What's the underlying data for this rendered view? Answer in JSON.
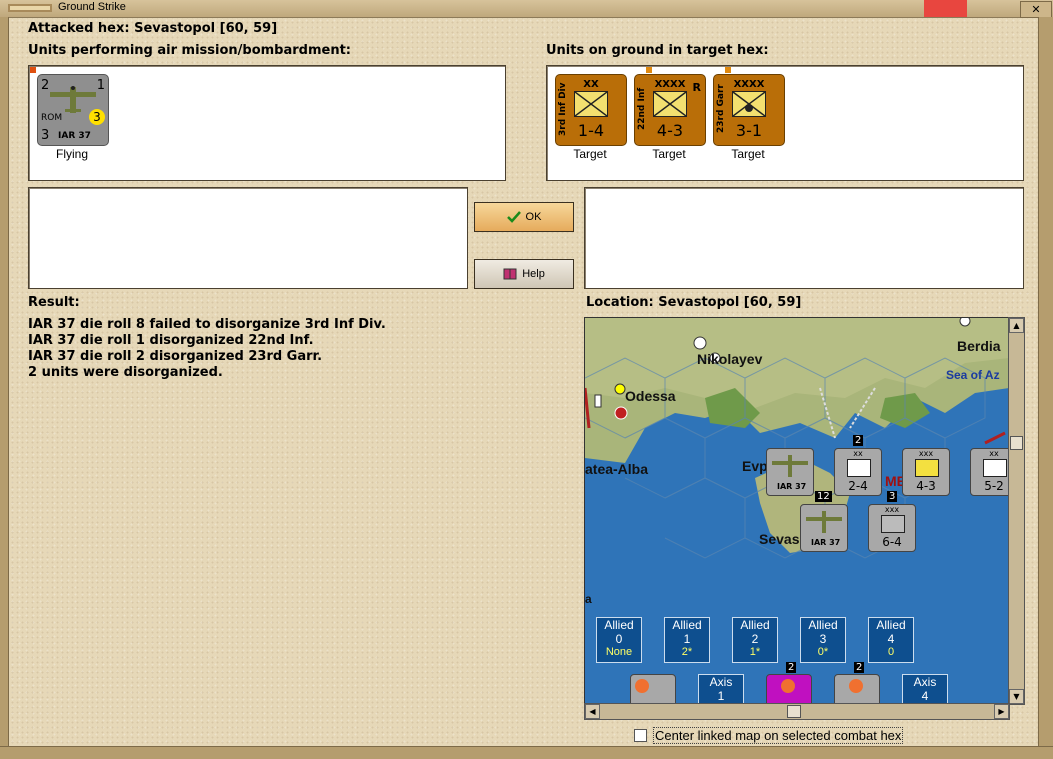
{
  "window": {
    "title": "Ground Strike"
  },
  "attacked_hex": "Attacked hex: Sevastopol  [60, 59]",
  "air_units": {
    "label": "Units performing air mission/bombardment:",
    "items": [
      {
        "top_left": "2",
        "top_right": "1",
        "nation": "ROM",
        "type": "IAR 37",
        "bottom_left": "3",
        "circle": "3",
        "status": "Flying"
      }
    ]
  },
  "ground_units": {
    "label": "Units on ground in target hex:",
    "items": [
      {
        "name": "3rd Inf Div",
        "size": "XX",
        "strength": "1-4",
        "status": "Target"
      },
      {
        "name": "22nd Inf",
        "size": "XXXX",
        "corner": "R",
        "strength": "4-3",
        "status": "Target"
      },
      {
        "name": "23rd Garr",
        "size": "XXXX",
        "strength": "3-1",
        "status": "Target"
      }
    ]
  },
  "buttons": {
    "ok": "OK",
    "help": "Help"
  },
  "result": {
    "label": "Result:",
    "lines": [
      "IAR 37 die roll 8 failed to disorganize 3rd Inf Div.",
      "IAR 37 die roll 1 disorganized 22nd Inf.",
      "IAR 37 die roll 2 disorganized 23rd Garr.",
      "2 units were disorganized."
    ]
  },
  "location": {
    "label": "Location:  Sevastopol  [60, 59]",
    "map": {
      "places": [
        "Nikolayev",
        "Berdia",
        "Sea of Az",
        "Odessa",
        "atea-Alba",
        "Evp",
        "ME",
        "Sevas",
        "a"
      ],
      "map_counters": [
        {
          "stack": "",
          "strength": "",
          "type": "IAR 37"
        },
        {
          "stack": "2",
          "strength": "2-4",
          "size": "xx"
        },
        {
          "stack": "",
          "strength": "4-3",
          "size": "xxx"
        },
        {
          "stack": "",
          "strength": "5-2",
          "size": "xx"
        },
        {
          "stack": "12",
          "strength": "",
          "type": "IAR 37"
        },
        {
          "stack": "3",
          "strength": "6-4",
          "size": "xxx"
        }
      ],
      "allied": [
        {
          "title": "Allied",
          "num": "0",
          "val": "None"
        },
        {
          "title": "Allied",
          "num": "1",
          "val": "2*"
        },
        {
          "title": "Allied",
          "num": "2",
          "val": "1*"
        },
        {
          "title": "Allied",
          "num": "3",
          "val": "0*"
        },
        {
          "title": "Allied",
          "num": "4",
          "val": "0"
        }
      ],
      "axis": [
        {
          "title": "Axis",
          "num": "1"
        },
        {
          "title": "Axis",
          "num": "4"
        }
      ],
      "axis_counter_nums": [
        "2",
        "2"
      ]
    }
  },
  "center_map": {
    "label": "Center linked map on selected combat hex",
    "checked": false
  }
}
